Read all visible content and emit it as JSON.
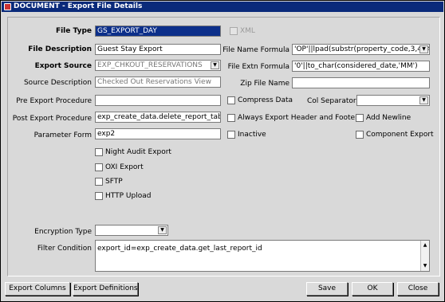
{
  "window": {
    "title": "DOCUMENT - Export File Details"
  },
  "form": {
    "file_type": {
      "label": "File Type",
      "value": "GS_EXPORT_DAY"
    },
    "xml": {
      "label": "XML",
      "checked": false,
      "enabled": false
    },
    "file_description": {
      "label": "File Description",
      "value": "Guest Stay Export"
    },
    "file_name_formula": {
      "label": "File Name Formula",
      "value": "'OP'||lpad(substr(property_code,3,4),4"
    },
    "export_source": {
      "label": "Export Source",
      "value": "EXP_CHKOUT_RESERVATIONS"
    },
    "file_extn_formula": {
      "label": "File Extn Formula",
      "value": "'0'||to_char(considered_date,'MM')"
    },
    "source_description": {
      "label": "Source Description",
      "value": "Checked Out Reservations View"
    },
    "zip_file_name": {
      "label": "Zip File Name",
      "value": ""
    },
    "pre_export_procedure": {
      "label": "Pre Export Procedure",
      "value": ""
    },
    "compress_data": {
      "label": "Compress Data",
      "checked": false
    },
    "col_separator": {
      "label": "Col Separator",
      "value": ""
    },
    "post_export_procedure": {
      "label": "Post Export Procedure",
      "value": "exp_create_data.delete_report_table"
    },
    "always_export_header_footer": {
      "label": "Always Export Header and Footer",
      "checked": false
    },
    "add_newline": {
      "label": "Add Newline",
      "checked": false
    },
    "parameter_form": {
      "label": "Parameter Form",
      "value": "exp2"
    },
    "inactive": {
      "label": "Inactive",
      "checked": false
    },
    "component_export": {
      "label": "Component Export",
      "checked": false
    },
    "night_audit_export": {
      "label": "Night Audit Export",
      "checked": false
    },
    "oxi_export": {
      "label": "OXI Export",
      "checked": false
    },
    "sftp": {
      "label": "SFTP",
      "checked": false
    },
    "http_upload": {
      "label": "HTTP Upload",
      "checked": false
    },
    "encryption_type": {
      "label": "Encryption Type",
      "value": ""
    },
    "filter_condition": {
      "label": "Filter Condition",
      "value": "export_id=exp_create_data.get_last_report_id"
    }
  },
  "buttons": {
    "export_columns": "Export Columns",
    "export_definitions": "Export Definitions",
    "save": "Save",
    "ok": "OK",
    "close": "Close"
  }
}
